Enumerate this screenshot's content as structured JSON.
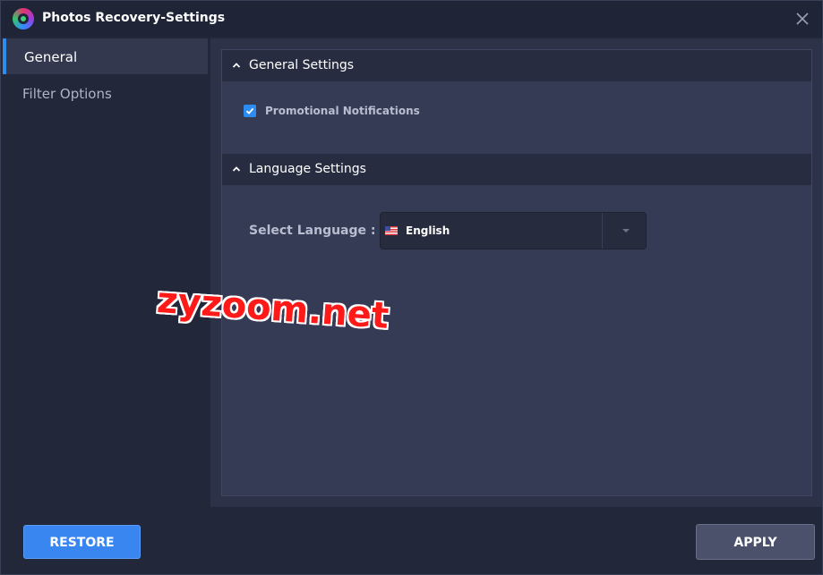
{
  "window": {
    "title": "Photos Recovery-Settings",
    "icons": {
      "app": "photos-recovery-logo-icon",
      "close": "close-icon"
    }
  },
  "sidebar": {
    "items": [
      {
        "label": "General",
        "active": true
      },
      {
        "label": "Filter Options",
        "active": false
      }
    ]
  },
  "general_settings": {
    "title": "General Settings",
    "icon": "chevron-up-icon",
    "promotional_notifications": {
      "label": "Promotional Notifications",
      "checked": true
    }
  },
  "language_settings": {
    "title": "Language Settings",
    "icon": "chevron-up-icon",
    "select_label": "Select Language :",
    "selected_language": "English",
    "flag_icon": "us-flag-icon"
  },
  "watermark": "zyzoom.net",
  "footer": {
    "restore_label": "RESTORE",
    "apply_label": "APPLY"
  },
  "colors": {
    "accent": "#2d8cf0",
    "background": "#22273a",
    "panel": "#363b55",
    "watermark": "#ff1a1a"
  }
}
